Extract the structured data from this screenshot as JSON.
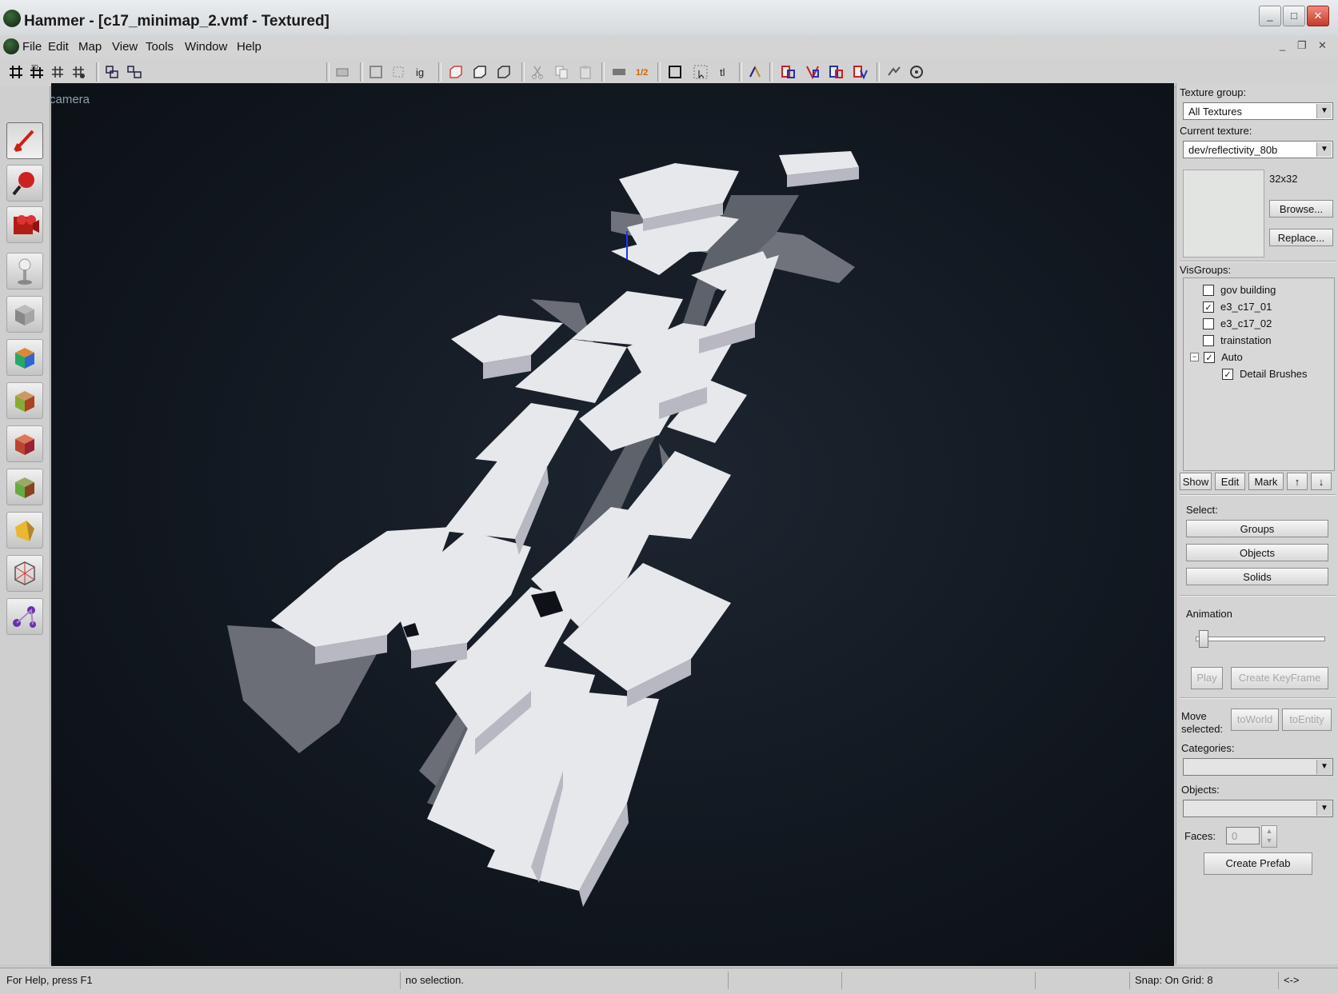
{
  "window": {
    "title": "Hammer - [c17_minimap_2.vmf - Textured]",
    "controls": {
      "minimize": "_",
      "maximize": "□",
      "close": "✕"
    }
  },
  "menu": {
    "items": [
      "File",
      "Edit",
      "Map",
      "View",
      "Tools",
      "Window",
      "Help"
    ],
    "mdi_controls": {
      "minimize": "_",
      "restore": "❐",
      "close": "✕"
    }
  },
  "toolbar": {
    "icons": [
      "grid-icon",
      "3d-grid-icon",
      "dot-grid-icon",
      "snap-grid-icon",
      "group-icon",
      "ungroup-icon",
      "carve-icon",
      "hollow-icon",
      "ig-icon",
      "cordon-icon",
      "cordon-toggle-icon",
      "undo-icon",
      "cut-icon",
      "copy-icon",
      "paste-icon",
      "texture-lock-icon",
      "decal-icon",
      "selection-box-icon",
      "select-icon",
      "texture-icon",
      "vertex-icon",
      "group-ignore-icon",
      "run-map-icon",
      "entity-report-icon"
    ]
  },
  "palette": {
    "tools": [
      "selection-tool",
      "magnify-tool",
      "camera-tool",
      "entity-tool",
      "block-tool",
      "texture-application-tool",
      "apply-current-texture-tool",
      "decal-tool",
      "overlay-tool",
      "clipping-tool",
      "vertex-tool",
      "path-tool"
    ]
  },
  "viewport": {
    "label": "camera"
  },
  "texture": {
    "group_label": "Texture group:",
    "group_value": "All Textures",
    "current_label": "Current texture:",
    "current_value": "dev/reflectivity_80b",
    "size": "32x32",
    "browse": "Browse...",
    "replace": "Replace..."
  },
  "visgroups": {
    "label": "VisGroups:",
    "items": [
      {
        "name": "gov building",
        "checked": false
      },
      {
        "name": "e3_c17_01",
        "checked": true
      },
      {
        "name": "e3_c17_02",
        "checked": false
      },
      {
        "name": "trainstation",
        "checked": false
      },
      {
        "name": "Auto",
        "checked": true,
        "expanded": true
      },
      {
        "name": "Detail Brushes",
        "checked": true
      }
    ],
    "buttons": {
      "show": "Show",
      "edit": "Edit",
      "mark": "Mark",
      "up": "↑",
      "down": "↓"
    }
  },
  "select": {
    "label": "Select:",
    "groups": "Groups",
    "objects": "Objects",
    "solids": "Solids"
  },
  "animation": {
    "label": "Animation",
    "play": "Play",
    "create_keyframe": "Create KeyFrame"
  },
  "move_selected": {
    "label_line1": "Move",
    "label_line2": "selected:",
    "to_world": "toWorld",
    "to_entity": "toEntity"
  },
  "categories": {
    "label": "Categories:",
    "value": ""
  },
  "objects": {
    "label": "Objects:",
    "value": ""
  },
  "faces": {
    "label": "Faces:",
    "value": "0"
  },
  "create_prefab": "Create Prefab",
  "status": {
    "help": "For Help, press F1",
    "selection": "no selection.",
    "snap": "Snap: On Grid: 8",
    "arrows": "<->"
  },
  "colors": {
    "viewport_bg": "#121820",
    "building": "#e9e9ee",
    "building_side": "#b9b9c2",
    "shadow": "#6d7078"
  }
}
